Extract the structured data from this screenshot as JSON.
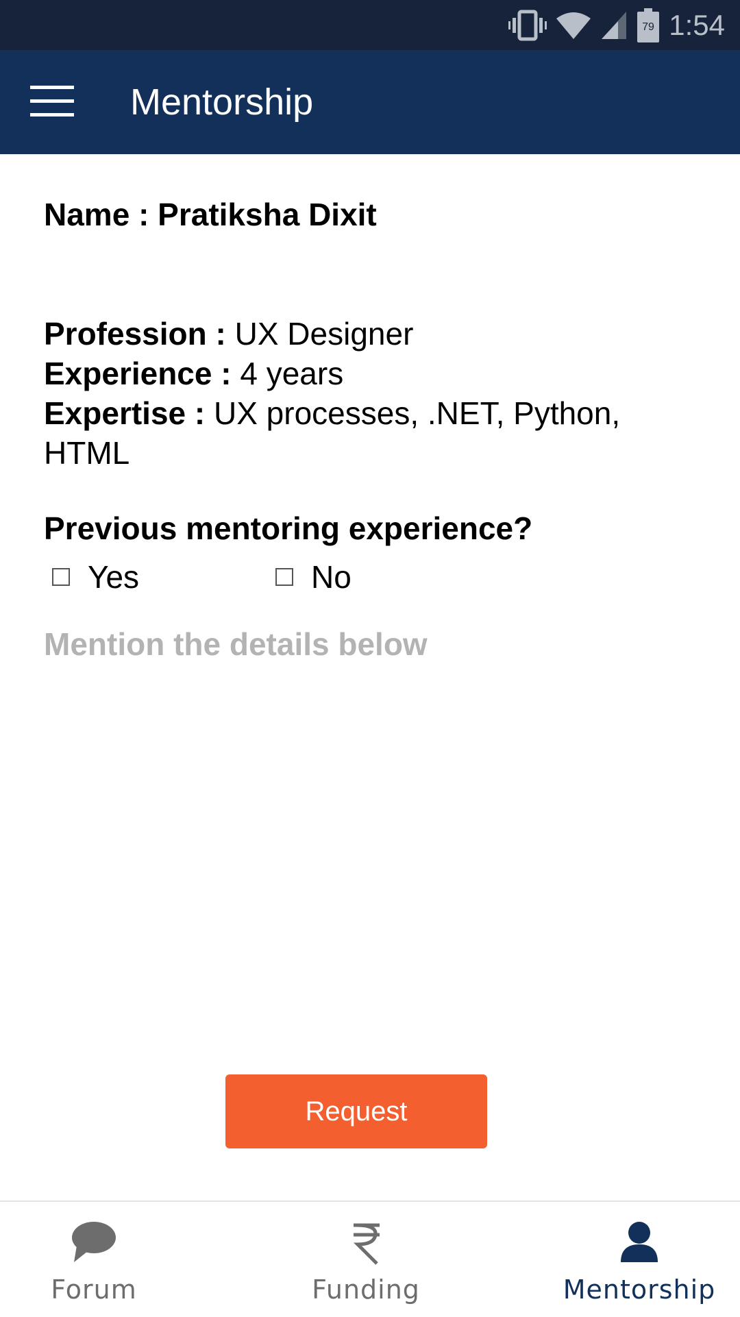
{
  "status_bar": {
    "time": "1:54",
    "battery_level": "79"
  },
  "app_bar": {
    "title": "Mentorship"
  },
  "profile": {
    "name_label": "Name : ",
    "name_value": "Pratiksha Dixit",
    "profession_label": "Profession : ",
    "profession_value": "UX Designer",
    "experience_label": "Experience : ",
    "experience_value": "4 years",
    "expertise_label": "Expertise : ",
    "expertise_value": "UX processes, .NET, Python, HTML"
  },
  "question": {
    "text": "Previous mentoring experience?",
    "options": [
      "Yes",
      "No"
    ]
  },
  "details": {
    "placeholder": "Mention the details below",
    "value": ""
  },
  "request_button": {
    "label": "Request"
  },
  "bottom_nav": {
    "items": [
      {
        "label": "Forum",
        "icon": "chat-bubble-icon",
        "active": false
      },
      {
        "label": "Funding",
        "icon": "rupee-icon",
        "active": false
      },
      {
        "label": "Mentorship",
        "icon": "person-icon",
        "active": true
      }
    ]
  },
  "colors": {
    "status_bar": "#16233a",
    "app_bar": "#12305a",
    "accent": "#f45f30",
    "nav_active": "#12305a",
    "nav_inactive": "#6d6d6d",
    "placeholder": "#b3b3b3"
  }
}
